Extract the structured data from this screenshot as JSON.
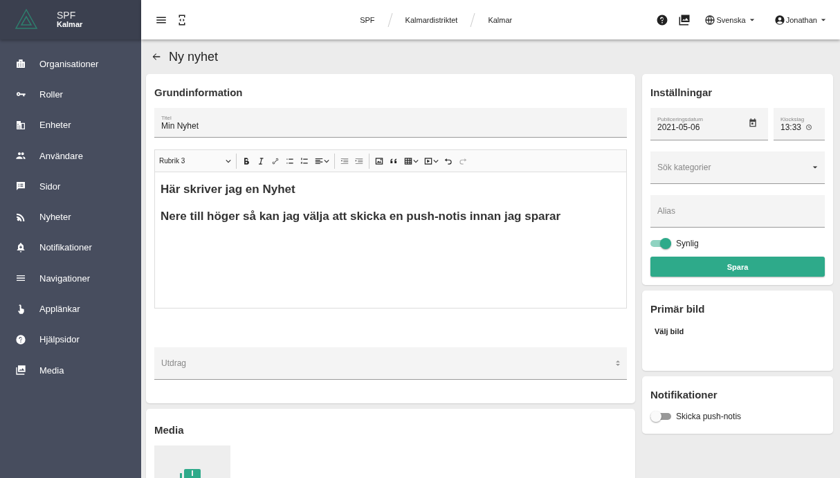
{
  "brand": {
    "name": "SPF",
    "subtitle": "Kalmar"
  },
  "sidebar": {
    "items": [
      {
        "label": "Organisationer"
      },
      {
        "label": "Roller"
      },
      {
        "label": "Enheter"
      },
      {
        "label": "Användare"
      },
      {
        "label": "Sidor"
      },
      {
        "label": "Nyheter"
      },
      {
        "label": "Notifikationer"
      },
      {
        "label": "Navigationer"
      },
      {
        "label": "Applänkar"
      },
      {
        "label": "Hjälpsidor"
      },
      {
        "label": "Media"
      }
    ]
  },
  "breadcrumbs": [
    "SPF",
    "Kalmardistriktet",
    "Kalmar"
  ],
  "language": "Svenska",
  "user": "Jonathan",
  "page_title": "Ny nyhet",
  "basic": {
    "title": "Grundinformation",
    "title_field": {
      "label": "Titel",
      "value": "Min Nyhet"
    },
    "block_format": "Rubrik 3",
    "content": [
      "Här skriver jag en Nyhet",
      "Nere till höger så kan jag välja att skicka en push-notis innan jag sparar"
    ],
    "excerpt": {
      "placeholder": "Utdrag"
    }
  },
  "media": {
    "title": "Media"
  },
  "settings": {
    "title": "Inställningar",
    "date": {
      "label": "Publiceringsdatum",
      "value": "2021-05-06"
    },
    "time": {
      "label": "Klockslag",
      "value": "13:33"
    },
    "categories": {
      "placeholder": "Sök kategorier"
    },
    "alias": {
      "placeholder": "Alias"
    },
    "visible": {
      "label": "Synlig",
      "on": true
    },
    "save": "Spara"
  },
  "primary_image": {
    "title": "Primär bild",
    "choose": "Välj bild"
  },
  "notifications": {
    "title": "Notifikationer",
    "push": {
      "label": "Skicka push-notis",
      "on": false
    }
  }
}
